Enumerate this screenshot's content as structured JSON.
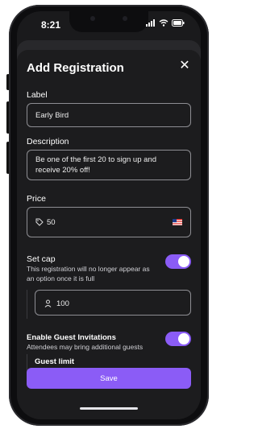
{
  "status": {
    "time": "8:21"
  },
  "sheet": {
    "title": "Add Registration",
    "label_heading": "Label",
    "label_value": "Early Bird",
    "description_heading": "Description",
    "description_value": "Be one of the first 20 to sign up and receive 20% off!",
    "price_heading": "Price",
    "price_value": "50",
    "set_cap_heading": "Set cap",
    "set_cap_sub": "This registration will no longer appear as an option once it is full",
    "set_cap_on": true,
    "cap_value": "100",
    "guest_heading": "Enable Guest Invitations",
    "guest_sub": "Attendees may bring additional guests",
    "guest_on": true,
    "guest_limit_heading": "Guest limit",
    "save_label": "Save"
  },
  "icons": {
    "close": "close-icon",
    "tag": "price-tag-icon",
    "flag": "us-flag-icon",
    "person": "person-icon",
    "wifi": "wifi-icon",
    "signal": "signal-icon",
    "battery": "battery-icon"
  },
  "colors": {
    "accent": "#8b5cf6",
    "sheet_bg": "#1c1c1e"
  }
}
